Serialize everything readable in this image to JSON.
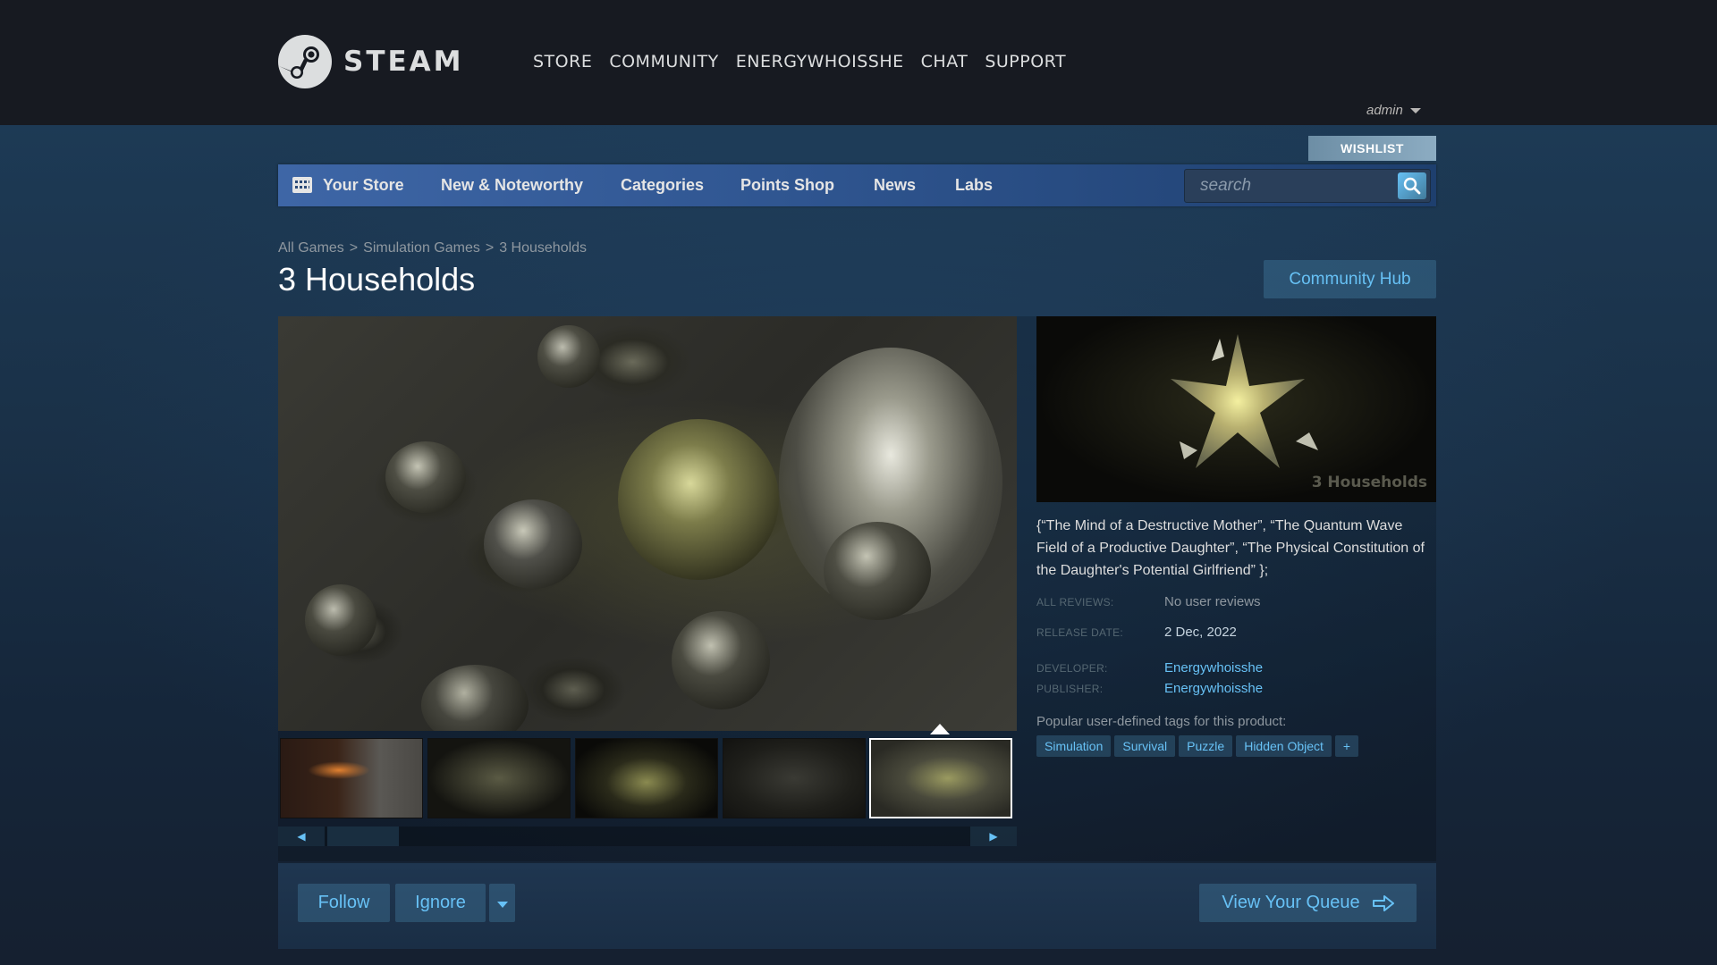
{
  "header": {
    "logo_text": "STEAM",
    "nav": [
      "STORE",
      "COMMUNITY",
      "ENERGYWHOISSHE",
      "CHAT",
      "SUPPORT"
    ],
    "account_name": "admin"
  },
  "wishlist_label": "WISHLIST",
  "store_nav": {
    "items": [
      "Your Store",
      "New & Noteworthy",
      "Categories",
      "Points Shop",
      "News",
      "Labs"
    ],
    "search_placeholder": "search"
  },
  "breadcrumb": [
    "All Games",
    "Simulation Games",
    "3 Households"
  ],
  "breadcrumb_separator": ">",
  "title": "3 Households",
  "community_hub_label": "Community Hub",
  "capsule_watermark": "3 Households",
  "description": "{“The Mind of a Destructive Mother”, “The Quantum Wave Field of a Productive Daughter”, “The Physical Constitution of the Daughter's Potential Girlfriend” };",
  "reviews": {
    "label": "ALL REVIEWS:",
    "value": "No user reviews"
  },
  "release": {
    "label": "RELEASE DATE:",
    "value": "2 Dec, 2022"
  },
  "developer": {
    "label": "DEVELOPER:",
    "value": "Energywhoisshe"
  },
  "publisher": {
    "label": "PUBLISHER:",
    "value": "Energywhoisshe"
  },
  "tags_label": "Popular user-defined tags for this product:",
  "tags": [
    "Simulation",
    "Survival",
    "Puzzle",
    "Hidden Object",
    "+"
  ],
  "thumbnails_selected_index": 4,
  "queue_bar": {
    "follow": "Follow",
    "ignore": "Ignore",
    "view_queue": "View Your Queue"
  },
  "colors": {
    "header_bg": "#171a21",
    "page_bg": "#1b2838",
    "accent": "#67c1f5",
    "store_nav_start": "#3e66a6",
    "store_nav_end": "#1e3f6e"
  }
}
